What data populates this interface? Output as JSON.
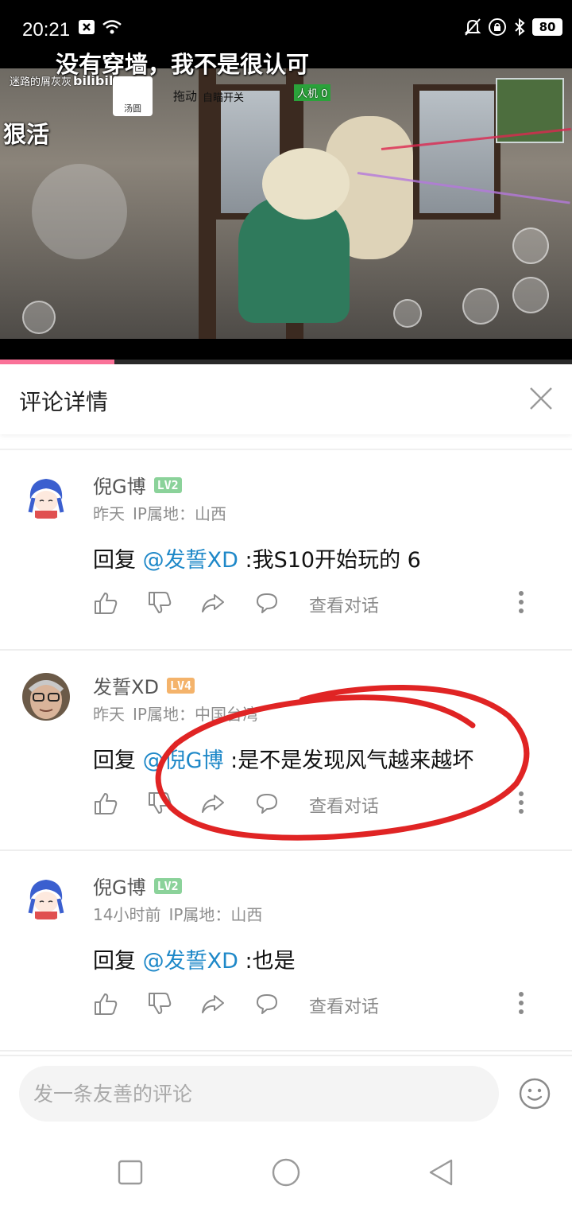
{
  "status_bar": {
    "time": "20:21",
    "left_icons": [
      "close-box-icon",
      "wifi-icon"
    ],
    "right_icons": [
      "mute-bell-icon",
      "lock-rotation-icon",
      "bluetooth-icon"
    ],
    "battery": "80"
  },
  "video": {
    "danmaku": [
      "没有穿墙，我不是很认可",
      "狠活"
    ],
    "overlay_texts": [
      "迷路的屑灰灰",
      "bilibili",
      "汤圆",
      "拖动",
      "自瞄开关",
      "人机 0"
    ],
    "progress": 0.2
  },
  "header": {
    "title": "评论详情",
    "close_icon": "close-icon"
  },
  "comments": [
    {
      "username": "倪G博",
      "level": "LV2",
      "level_color": "#8bd29a",
      "time": "昨天",
      "ip_label": "IP属地：山西",
      "reply_prefix": "回复 ",
      "mention": "@发誓XD",
      "text": " :我S10开始玩的  6",
      "view_conversation": "查看对话"
    },
    {
      "username": "发誓XD",
      "level": "LV4",
      "level_color": "#f4b36b",
      "time": "昨天",
      "ip_label": "IP属地：中国台湾",
      "reply_prefix": "回复 ",
      "mention": "@倪G博",
      "text": " :是不是发现风气越来越坏",
      "view_conversation": "查看对话"
    },
    {
      "username": "倪G博",
      "level": "LV2",
      "level_color": "#8bd29a",
      "time": "14小时前",
      "ip_label": "IP属地：山西",
      "reply_prefix": "回复 ",
      "mention": "@发誓XD",
      "text": " :也是",
      "view_conversation": "查看对话"
    }
  ],
  "action_icons": [
    "thumbs-up-icon",
    "thumbs-down-icon",
    "share-icon",
    "comment-bubble-icon",
    "more-vertical-icon"
  ],
  "input": {
    "placeholder": "发一条友善的评论",
    "value": ""
  },
  "emoji_icon": "emoji-icon",
  "nav_icons": [
    "recent-apps-icon",
    "home-icon",
    "back-icon"
  ],
  "colors": {
    "accent_pink": "#fb7299",
    "mention_blue": "#1e88c8",
    "annotation_red": "#e02424"
  }
}
